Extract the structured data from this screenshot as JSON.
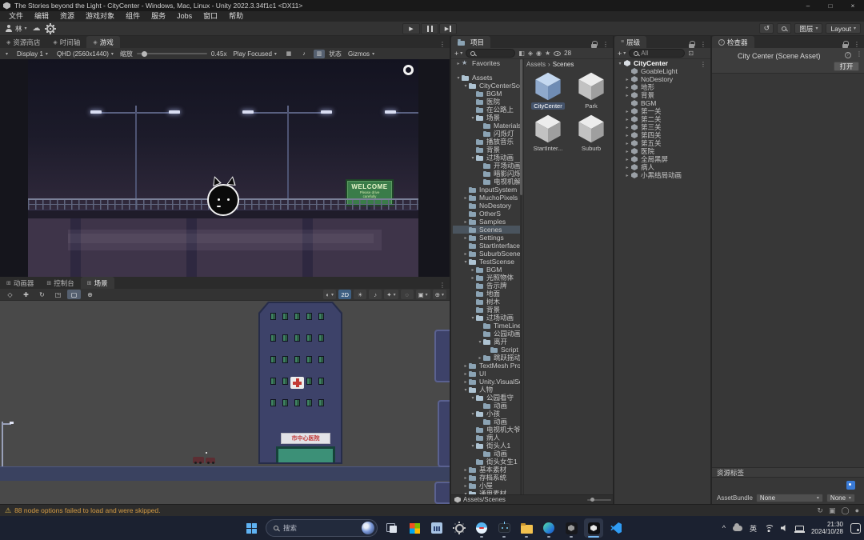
{
  "window": {
    "title": "The Stories beyond the Light - CityCenter - Windows, Mac, Linux - Unity 2022.3.34f1c1 <DX11>"
  },
  "menubar": {
    "items": [
      {
        "label": "文件"
      },
      {
        "label": "编辑"
      },
      {
        "label": "资源"
      },
      {
        "label": "游戏对象"
      },
      {
        "label": "组件"
      },
      {
        "label": "服务"
      },
      {
        "label": "Jobs"
      },
      {
        "label": "窗口"
      },
      {
        "label": "帮助"
      }
    ]
  },
  "toolbar": {
    "account": "林",
    "layers": "图层",
    "layout": "Layout"
  },
  "game_panel": {
    "tabs": [
      {
        "label": "资源商店",
        "icon": "store"
      },
      {
        "label": "时间轴",
        "icon": "timeline"
      },
      {
        "label": "游戏",
        "icon": "game",
        "active": true
      }
    ],
    "toolbar": {
      "display": "Display 1",
      "resolution": "QHD (2560x1440)",
      "zoom_label": "缩放",
      "zoom_value": "0.45x",
      "focus_mode": "Play Focused",
      "stats_label": "状态",
      "gizmos_label": "Gizmos"
    },
    "scene": {
      "sign_title": "WELCOME",
      "sign_line1": "Please drive",
      "sign_line2": "carefully"
    }
  },
  "scene_panel": {
    "tabs": [
      {
        "label": "动画器",
        "icon": "animator"
      },
      {
        "label": "控制台",
        "icon": "console"
      },
      {
        "label": "场景",
        "icon": "scenetab",
        "active": true
      }
    ],
    "toolbar": {
      "mode_2d": "2D"
    },
    "view": {
      "hospital_sign": "市中心医院"
    }
  },
  "project": {
    "tab": "项目",
    "count": "28",
    "favorites": [
      {
        "label": "Favorites",
        "icon": "star",
        "arrow": "▸",
        "indent": 0
      }
    ],
    "tree": [
      {
        "label": "Assets",
        "icon": "folder-open",
        "arrow": "▾",
        "indent": 0
      },
      {
        "label": "CityCenterSce",
        "icon": "folder-open",
        "arrow": "▾",
        "indent": 1
      },
      {
        "label": "BGM",
        "icon": "folder",
        "arrow": "",
        "indent": 2
      },
      {
        "label": "医院",
        "icon": "folder",
        "arrow": "",
        "indent": 2
      },
      {
        "label": "在公路上",
        "icon": "folder",
        "arrow": "",
        "indent": 2
      },
      {
        "label": "场景",
        "icon": "folder-open",
        "arrow": "▾",
        "indent": 2
      },
      {
        "label": "Materials",
        "icon": "folder",
        "arrow": "",
        "indent": 3
      },
      {
        "label": "闪烁灯",
        "icon": "folder",
        "arrow": "",
        "indent": 3
      },
      {
        "label": "播放音乐",
        "icon": "folder",
        "arrow": "",
        "indent": 2
      },
      {
        "label": "背景",
        "icon": "folder",
        "arrow": "",
        "indent": 2
      },
      {
        "label": "过场动画",
        "icon": "folder-open",
        "arrow": "▾",
        "indent": 2
      },
      {
        "label": "开场动画",
        "icon": "folder",
        "arrow": "",
        "indent": 3
      },
      {
        "label": "暗影闪烁灯",
        "icon": "folder",
        "arrow": "",
        "indent": 3
      },
      {
        "label": "电视机解说",
        "icon": "folder",
        "arrow": "",
        "indent": 3
      },
      {
        "label": "InputSystem",
        "icon": "folder",
        "arrow": "",
        "indent": 1
      },
      {
        "label": "MuchoPixels",
        "icon": "folder",
        "arrow": "▸",
        "indent": 1
      },
      {
        "label": "NoDestory",
        "icon": "folder",
        "arrow": "",
        "indent": 1
      },
      {
        "label": "OtherS",
        "icon": "folder",
        "arrow": "",
        "indent": 1
      },
      {
        "label": "Samples",
        "icon": "folder",
        "arrow": "▸",
        "indent": 1
      },
      {
        "label": "Scenes",
        "icon": "folder",
        "arrow": "",
        "indent": 1,
        "sel": true
      },
      {
        "label": "Settings",
        "icon": "folder",
        "arrow": "▸",
        "indent": 1
      },
      {
        "label": "StartInterface",
        "icon": "folder",
        "arrow": "",
        "indent": 1
      },
      {
        "label": "SuburbScenes",
        "icon": "folder",
        "arrow": "▸",
        "indent": 1
      },
      {
        "label": "TestScense",
        "icon": "folder-open",
        "arrow": "▾",
        "indent": 1
      },
      {
        "label": "BGM",
        "icon": "folder",
        "arrow": "▸",
        "indent": 2
      },
      {
        "label": "光照物体",
        "icon": "folder",
        "arrow": "▸",
        "indent": 2
      },
      {
        "label": "告示牌",
        "icon": "folder",
        "arrow": "",
        "indent": 2
      },
      {
        "label": "地面",
        "icon": "folder",
        "arrow": "",
        "indent": 2
      },
      {
        "label": "树木",
        "icon": "folder",
        "arrow": "",
        "indent": 2
      },
      {
        "label": "背景",
        "icon": "folder",
        "arrow": "",
        "indent": 2
      },
      {
        "label": "过场动画",
        "icon": "folder-open",
        "arrow": "▾",
        "indent": 2
      },
      {
        "label": "TimeLine",
        "icon": "folder",
        "arrow": "",
        "indent": 3
      },
      {
        "label": "公园动画",
        "icon": "folder",
        "arrow": "",
        "indent": 3
      },
      {
        "label": "离开",
        "icon": "folder-open",
        "arrow": "▾",
        "indent": 3
      },
      {
        "label": "Script",
        "icon": "folder",
        "arrow": "",
        "indent": 4
      },
      {
        "label": "跳跃摇动",
        "icon": "folder",
        "arrow": "▸",
        "indent": 3
      },
      {
        "label": "TextMesh Pro",
        "icon": "folder",
        "arrow": "▸",
        "indent": 1
      },
      {
        "label": "UI",
        "icon": "folder",
        "arrow": "▸",
        "indent": 1
      },
      {
        "label": "Unity.VisualSc",
        "icon": "folder",
        "arrow": "▸",
        "indent": 1
      },
      {
        "label": "人物",
        "icon": "folder-open",
        "arrow": "▾",
        "indent": 1
      },
      {
        "label": "公园看守",
        "icon": "folder-open",
        "arrow": "▾",
        "indent": 2
      },
      {
        "label": "动画",
        "icon": "folder",
        "arrow": "",
        "indent": 3
      },
      {
        "label": "小孩",
        "icon": "folder-open",
        "arrow": "▾",
        "indent": 2
      },
      {
        "label": "动画",
        "icon": "folder",
        "arrow": "",
        "indent": 3
      },
      {
        "label": "电视机大爷",
        "icon": "folder",
        "arrow": "",
        "indent": 2
      },
      {
        "label": "病人",
        "icon": "folder",
        "arrow": "",
        "indent": 2
      },
      {
        "label": "街头人1",
        "icon": "folder-open",
        "arrow": "▾",
        "indent": 2
      },
      {
        "label": "动画",
        "icon": "folder",
        "arrow": "",
        "indent": 3
      },
      {
        "label": "街头女生1",
        "icon": "folder",
        "arrow": "",
        "indent": 2
      },
      {
        "label": "基本素材",
        "icon": "folder",
        "arrow": "▸",
        "indent": 1
      },
      {
        "label": "存档系统",
        "icon": "folder",
        "arrow": "▸",
        "indent": 1
      },
      {
        "label": "小屋",
        "icon": "folder",
        "arrow": "▸",
        "indent": 1
      },
      {
        "label": "通用素材",
        "icon": "folder-open",
        "arrow": "▾",
        "indent": 1
      }
    ],
    "breadcrumb": {
      "root": "Assets",
      "sep": "›",
      "current": "Scenes"
    },
    "assets": [
      {
        "label": "CityCenter",
        "sel": true
      },
      {
        "label": "Park"
      },
      {
        "label": "StartInter..."
      },
      {
        "label": "Suburb"
      }
    ],
    "path_bar": "Assets/Scenes"
  },
  "hierarchy": {
    "tab": "层级",
    "search_value": "All",
    "tree": [
      {
        "label": "CityCenter",
        "icon": "scene",
        "arrow": "▾",
        "indent": 0,
        "bold": true
      },
      {
        "label": "GoableLight",
        "icon": "cube",
        "arrow": "",
        "indent": 1
      },
      {
        "label": "NoDestory",
        "icon": "cube",
        "arrow": "▸",
        "indent": 1
      },
      {
        "label": "地形",
        "icon": "cube",
        "arrow": "▸",
        "indent": 1
      },
      {
        "label": "背景",
        "icon": "cube",
        "arrow": "▸",
        "indent": 1
      },
      {
        "label": "BGM",
        "icon": "cube",
        "arrow": "",
        "indent": 1
      },
      {
        "label": "第一关",
        "icon": "cube",
        "arrow": "▸",
        "indent": 1
      },
      {
        "label": "第二关",
        "icon": "cube",
        "arrow": "▸",
        "indent": 1
      },
      {
        "label": "第三关",
        "icon": "cube",
        "arrow": "▸",
        "indent": 1
      },
      {
        "label": "第四关",
        "icon": "cube",
        "arrow": "▸",
        "indent": 1
      },
      {
        "label": "第五关",
        "icon": "cube",
        "arrow": "▸",
        "indent": 1
      },
      {
        "label": "医院",
        "icon": "cube",
        "arrow": "▸",
        "indent": 1
      },
      {
        "label": "全局黑屏",
        "icon": "cube",
        "arrow": "▸",
        "indent": 1
      },
      {
        "label": "病人",
        "icon": "cube",
        "arrow": "▸",
        "indent": 1
      },
      {
        "label": "小黑结局动画",
        "icon": "cube",
        "arrow": "▸",
        "indent": 1
      }
    ]
  },
  "inspector": {
    "tab": "检查器",
    "asset_title": "City Center (Scene Asset)",
    "open_button": "打开",
    "labels_header": "资源标签",
    "assetbundle_label": "AssetBundle",
    "bundle_value": "None",
    "variant_value": "None"
  },
  "statusbar": {
    "message": "88 node options failed to load and were skipped."
  },
  "taskbar": {
    "search_placeholder": "搜索",
    "apps": [
      {
        "name": "task-view"
      },
      {
        "name": "ms-store"
      },
      {
        "name": "performance"
      },
      {
        "name": "settings"
      },
      {
        "name": "qq",
        "dot": true
      },
      {
        "name": "robot",
        "dot": true
      },
      {
        "name": "file-explorer",
        "dot": true
      },
      {
        "name": "edge",
        "dot": true
      },
      {
        "name": "unity-hub",
        "dot": true
      },
      {
        "name": "unity-editor",
        "active": true
      },
      {
        "name": "vscode"
      }
    ],
    "tray": [
      {
        "name": "tray-chevron",
        "glyph": "^"
      },
      {
        "name": "onedrive"
      },
      {
        "name": "ime",
        "label": "英"
      },
      {
        "name": "wifi"
      },
      {
        "name": "volume"
      },
      {
        "name": "battery"
      }
    ],
    "clock": {
      "time": "21:30",
      "date": "2024/10/28"
    }
  }
}
